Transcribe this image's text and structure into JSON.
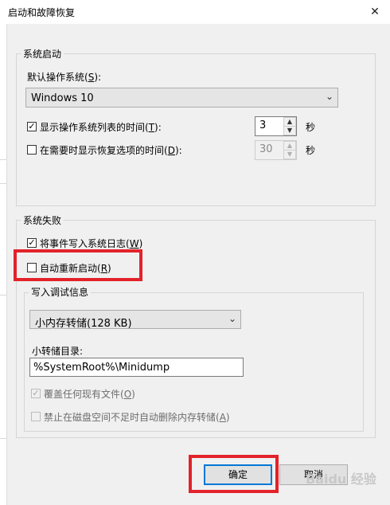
{
  "window": {
    "title": "启动和故障恢复",
    "close_symbol": "✕"
  },
  "startup": {
    "legend": "系统启动",
    "default_os_label_prefix": "默认操作系统(",
    "default_os_key": "S",
    "default_os_label_suffix": "):",
    "default_os_value": "Windows 10",
    "show_os_list": {
      "checked": true,
      "label_prefix": "显示操作系统列表的时间(",
      "key": "T",
      "label_suffix": "):",
      "value": "3",
      "unit": "秒"
    },
    "show_recovery": {
      "checked": false,
      "label_prefix": "在需要时显示恢复选项的时间(",
      "key": "D",
      "label_suffix": "):",
      "value": "30",
      "unit": "秒"
    }
  },
  "failure": {
    "legend": "系统失败",
    "write_event": {
      "checked": true,
      "label_prefix": "将事件写入系统日志(",
      "key": "W",
      "label_suffix": ")"
    },
    "auto_restart": {
      "checked": false,
      "label_prefix": "自动重新启动(",
      "key": "R",
      "label_suffix": ")"
    },
    "debug": {
      "legend": "写入调试信息",
      "dump_type": "小内存转储(128 KB)",
      "dump_dir_label": "小转储目录:",
      "dump_dir_value": "%SystemRoot%\\Minidump",
      "overwrite": {
        "checked": true,
        "disabled": true,
        "label_prefix": "覆盖任何现有文件(",
        "key": "O",
        "label_suffix": ")"
      },
      "disable_autodelete": {
        "checked": false,
        "disabled": true,
        "label_prefix": "禁止在磁盘空间不足时自动删除内存转储(",
        "key": "A",
        "label_suffix": ")"
      }
    }
  },
  "buttons": {
    "ok": "确定",
    "cancel": "取消"
  },
  "icons": {
    "check": "✓",
    "dropdown": "⌄",
    "spin_up": "▲",
    "spin_down": "▼"
  },
  "highlight_color": "#e3222a",
  "watermark": "Baidu 经验"
}
